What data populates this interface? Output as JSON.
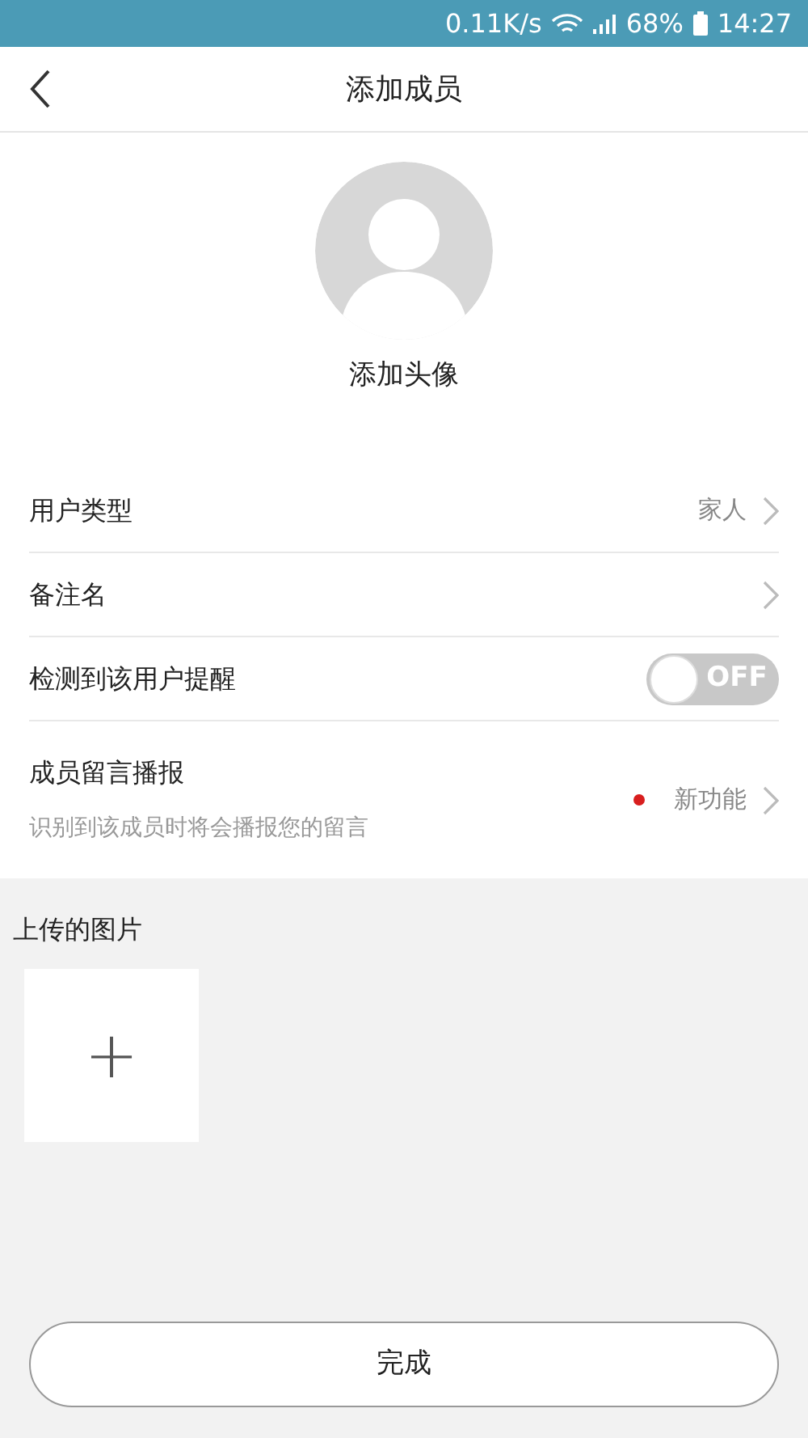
{
  "status_bar": {
    "speed": "0.11K/s",
    "battery": "68%",
    "time": "14:27"
  },
  "header": {
    "title": "添加成员"
  },
  "avatar": {
    "label": "添加头像"
  },
  "rows": [
    {
      "kind": "link",
      "label": "用户类型",
      "value": "家人"
    },
    {
      "kind": "link",
      "label": "备注名"
    },
    {
      "kind": "toggle",
      "label": "检测到该用户提醒",
      "on": false,
      "state_text": "OFF"
    },
    {
      "kind": "link",
      "label": "成员留言播报",
      "subtitle": "识别到该成员时将会播报您的留言",
      "value": "新功能",
      "new_dot": true
    }
  ],
  "uploads": {
    "title": "上传的图片",
    "add_label": "+"
  },
  "done_button": "完成"
}
